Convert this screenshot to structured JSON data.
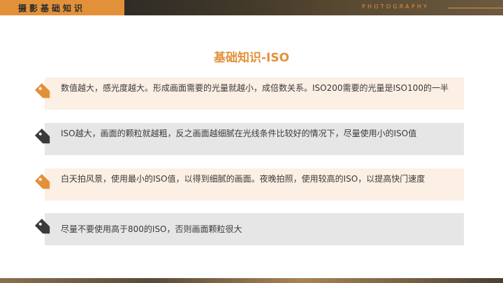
{
  "header": {
    "section_label": "摄影基础知识",
    "brand": "PHOTOGRAPHY"
  },
  "title": "基础知识-ISO",
  "items": [
    {
      "text": "数值越大，感光度越大。形成画面需要的光量就越小，成倍数关系。ISO200需要的光量是ISO100的一半",
      "icon": "price-tag-icon",
      "color": "#e2913a"
    },
    {
      "text": "ISO越大，画面的颗粒就越粗，反之画面越细腻在光线条件比较好的情况下，尽量使用小的ISO值",
      "icon": "price-tag-icon",
      "color": "#3a3a3a"
    },
    {
      "text": "白天拍风景，使用最小的ISO值，以得到细腻的画面。夜晚拍照，使用较高的ISO，以提高快门速度",
      "icon": "price-tag-icon",
      "color": "#e2913a"
    },
    {
      "text": "尽量不要使用高于800的ISO，否则画面颗粒很大",
      "icon": "price-tag-icon",
      "color": "#3a3a3a"
    }
  ]
}
